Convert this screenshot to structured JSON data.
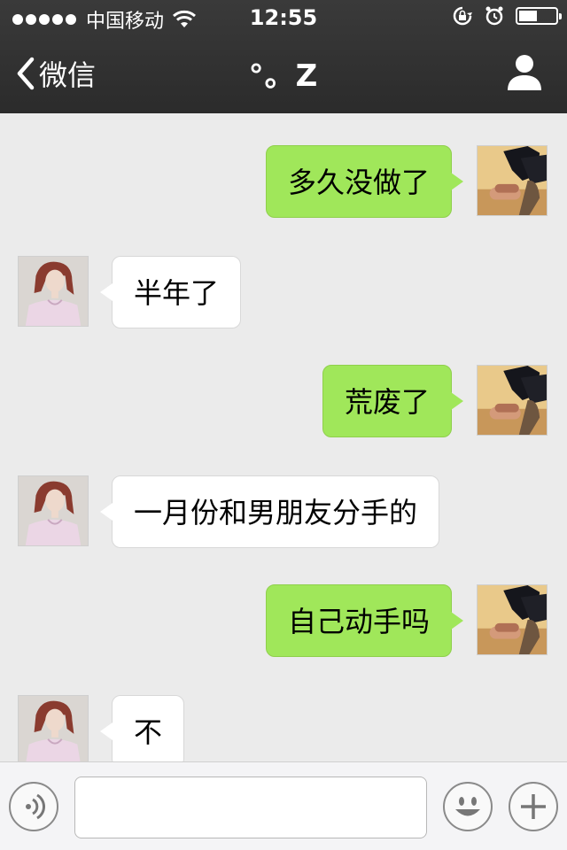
{
  "status": {
    "carrier": "中国移动",
    "time": "12:55"
  },
  "nav": {
    "back_label": "微信",
    "title": "°。Z"
  },
  "messages": [
    {
      "direction": "out",
      "text": "多久没做了"
    },
    {
      "direction": "in",
      "text": "半年了"
    },
    {
      "direction": "out",
      "text": "荒废了"
    },
    {
      "direction": "in",
      "text": "一月份和男朋友分手的"
    },
    {
      "direction": "out",
      "text": "自己动手吗"
    },
    {
      "direction": "in",
      "text": "不"
    }
  ],
  "input": {
    "value": ""
  },
  "icons": {
    "back": "chevron-left-icon",
    "profile": "person-icon",
    "voice": "voice-icon",
    "emoji": "smiley-icon",
    "plus": "plus-icon"
  },
  "colors": {
    "outgoing_bubble": "#a0e75a",
    "incoming_bubble": "#ffffff",
    "nav_bar": "#2f2f2f",
    "chat_background": "#ebebeb"
  }
}
